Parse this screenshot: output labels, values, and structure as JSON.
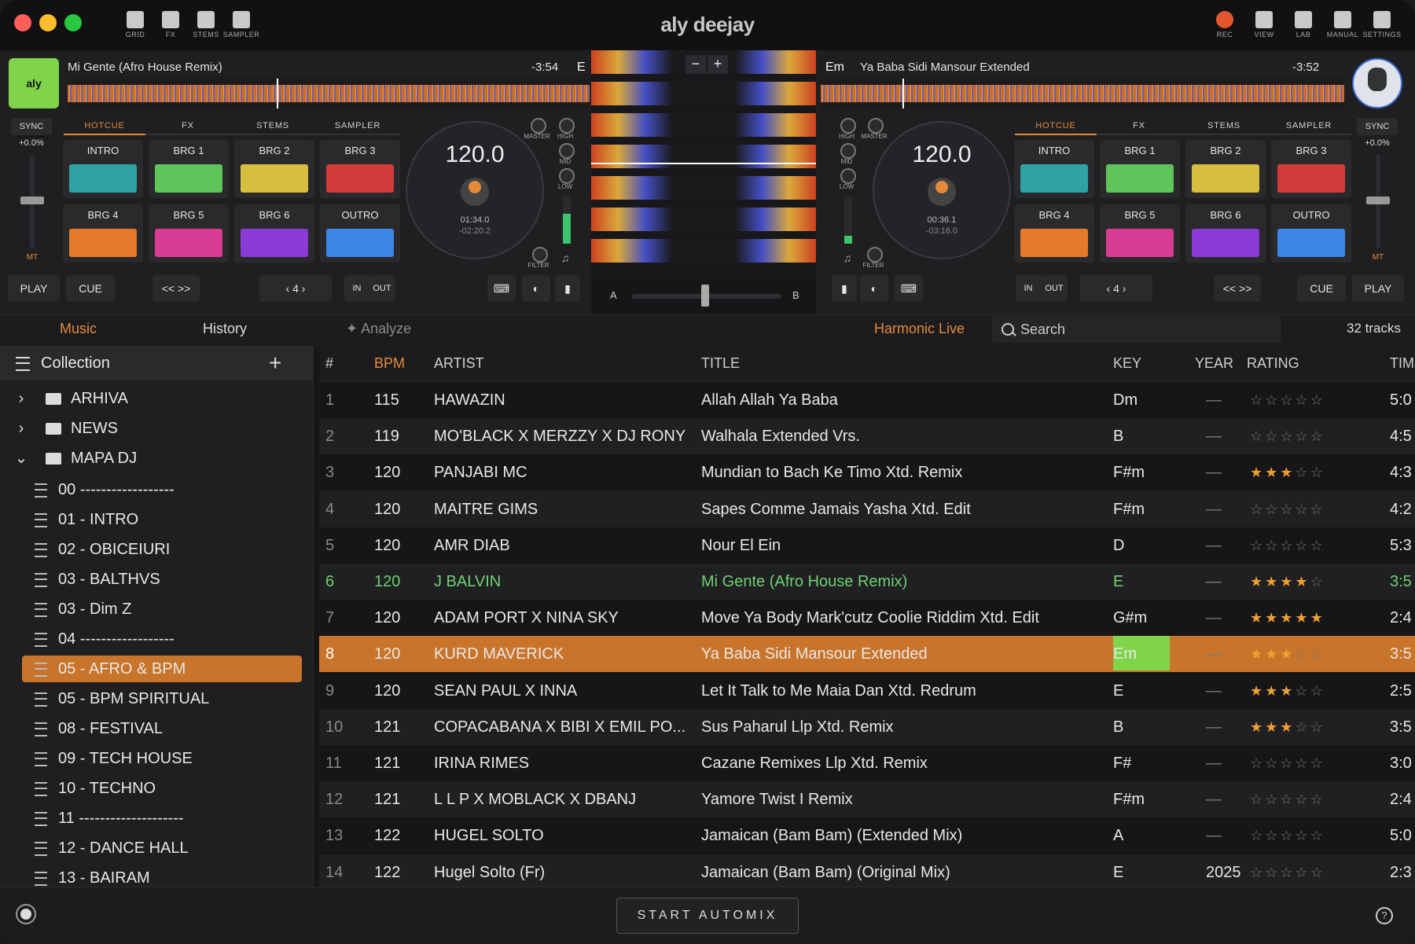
{
  "window": {
    "title": "aly deejay"
  },
  "toolbar_left": [
    {
      "label": "GRID",
      "icon": "grid-icon"
    },
    {
      "label": "FX",
      "icon": "fx-icon"
    },
    {
      "label": "STEMS",
      "icon": "stems-icon"
    },
    {
      "label": "SAMPLER",
      "icon": "sampler-icon"
    }
  ],
  "toolbar_right": [
    {
      "label": "REC",
      "icon": "record-icon"
    },
    {
      "label": "VIEW",
      "icon": "view-icon"
    },
    {
      "label": "LAB",
      "icon": "flask-icon"
    },
    {
      "label": "MANUAL",
      "icon": "book-icon"
    },
    {
      "label": "SETTINGS",
      "icon": "gear-icon"
    }
  ],
  "deck_left": {
    "logo": "aly deejay",
    "track": "Mi Gente (Afro House Remix)",
    "remaining": "-3:54",
    "key": "E",
    "tabs": [
      "HOTCUE",
      "FX",
      "STEMS",
      "SAMPLER"
    ],
    "sync": "SYNC",
    "pitch": "+0.0%",
    "mt": "MT",
    "bpm": "120.0",
    "elapsed": "01:34.0",
    "remain": "-02:20.2",
    "pads": [
      {
        "label": "INTRO",
        "color": "#2fa3a3"
      },
      {
        "label": "BRG 1",
        "color": "#5fc45a"
      },
      {
        "label": "BRG 2",
        "color": "#d6be3f"
      },
      {
        "label": "BRG 3",
        "color": "#d33b3b"
      },
      {
        "label": "BRG 4",
        "color": "#e47a2a"
      },
      {
        "label": "BRG 5",
        "color": "#d83d93"
      },
      {
        "label": "BRG 6",
        "color": "#8a3bd6"
      },
      {
        "label": "OUTRO",
        "color": "#3b86e6"
      }
    ],
    "play": "PLAY",
    "cue": "CUE",
    "seek": "<< >>",
    "loop": "4",
    "in": "IN",
    "out": "OUT",
    "knobs": {
      "master": "MASTER",
      "high": "HIGH",
      "mid": "MID",
      "low": "LOW",
      "filter": "FILTER"
    }
  },
  "deck_right": {
    "track": "Ya Baba Sidi Mansour Extended",
    "remaining": "-3:52",
    "key": "Em",
    "tabs": [
      "HOTCUE",
      "FX",
      "STEMS",
      "SAMPLER"
    ],
    "sync": "SYNC",
    "pitch": "+0.0%",
    "mt": "MT",
    "bpm": "120.0",
    "elapsed": "00:36.1",
    "remain": "-03:16.0",
    "pads": [
      {
        "label": "INTRO",
        "color": "#2fa3a3"
      },
      {
        "label": "BRG 1",
        "color": "#5fc45a"
      },
      {
        "label": "BRG 2",
        "color": "#d6be3f"
      },
      {
        "label": "BRG 3",
        "color": "#d33b3b"
      },
      {
        "label": "BRG 4",
        "color": "#e47a2a"
      },
      {
        "label": "BRG 5",
        "color": "#d83d93"
      },
      {
        "label": "BRG 6",
        "color": "#8a3bd6"
      },
      {
        "label": "OUTRO",
        "color": "#3b86e6"
      }
    ],
    "play": "PLAY",
    "cue": "CUE",
    "seek": "<< >>",
    "loop": "4",
    "in": "IN",
    "out": "OUT",
    "knobs": {
      "master": "MASTER",
      "high": "HIGH",
      "mid": "MID",
      "low": "LOW",
      "filter": "FILTER"
    }
  },
  "mixer": {
    "zoom_out": "−",
    "zoom_in": "+",
    "a": "A",
    "b": "B"
  },
  "library": {
    "tabs": {
      "music": "Music",
      "history": "History"
    },
    "analyze": "Analyze",
    "harmonic": "Harmonic Live",
    "search_placeholder": "Search",
    "count": "32 tracks",
    "collection": "Collection",
    "add": "+",
    "sidebar": [
      {
        "type": "folder",
        "label": "ARHIVA",
        "chev": "›"
      },
      {
        "type": "folder",
        "label": "NEWS",
        "chev": "›"
      },
      {
        "type": "folder",
        "label": "MAPA DJ",
        "chev": "⌄"
      },
      {
        "type": "list",
        "label": "00 ------------------"
      },
      {
        "type": "list",
        "label": "01 - INTRO"
      },
      {
        "type": "list",
        "label": "02 - OBICEIURI"
      },
      {
        "type": "list",
        "label": "03 - BALTHVS"
      },
      {
        "type": "list",
        "label": "03 - Dim Z"
      },
      {
        "type": "list",
        "label": "04 ------------------"
      },
      {
        "type": "list",
        "label": "05 - AFRO & BPM",
        "selected": true
      },
      {
        "type": "list",
        "label": "05 - BPM SPIRITUAL"
      },
      {
        "type": "list",
        "label": "08 - FESTIVAL"
      },
      {
        "type": "list",
        "label": "09 - TECH HOUSE"
      },
      {
        "type": "list",
        "label": "10 - TECHNO"
      },
      {
        "type": "list",
        "label": "11 --------------------"
      },
      {
        "type": "list",
        "label": "12 - DANCE HALL"
      },
      {
        "type": "list",
        "label": "13 - BAIRAM"
      }
    ],
    "columns": [
      "#",
      "BPM",
      "ARTIST",
      "TITLE",
      "KEY",
      "YEAR",
      "RATING",
      "TIM"
    ],
    "rows": [
      {
        "n": "1",
        "bpm": "115",
        "artist": "HAWAZIN",
        "title": "Allah Allah Ya Baba",
        "key": "Dm",
        "year": "—",
        "rating": 0,
        "time": "5:0"
      },
      {
        "n": "2",
        "bpm": "119",
        "artist": "MO'BLACK X MERZZY X DJ RONY",
        "title": "Walhala Extended Vrs.",
        "key": "B",
        "year": "—",
        "rating": 0,
        "time": "4:5"
      },
      {
        "n": "3",
        "bpm": "120",
        "artist": "PANJABI MC",
        "title": "Mundian to Bach Ke Timo Xtd. Remix",
        "key": "F#m",
        "year": "—",
        "rating": 3,
        "time": "4:3"
      },
      {
        "n": "4",
        "bpm": "120",
        "artist": "MAITRE GIMS",
        "title": "Sapes Comme Jamais Yasha Xtd. Edit",
        "key": "F#m",
        "year": "—",
        "rating": 0,
        "time": "4:2"
      },
      {
        "n": "5",
        "bpm": "120",
        "artist": "AMR DIAB",
        "title": "Nour El Ein",
        "key": "D",
        "year": "—",
        "rating": 0,
        "time": "5:3"
      },
      {
        "n": "6",
        "bpm": "120",
        "artist": "J BALVIN",
        "title": "Mi Gente (Afro House Remix)",
        "key": "E",
        "year": "—",
        "rating": 4,
        "time": "3:5",
        "playing": true
      },
      {
        "n": "7",
        "bpm": "120",
        "artist": "ADAM PORT X NINA SKY",
        "title": "Move Ya Body Mark'cutz Coolie Riddim Xtd. Edit",
        "key": "G#m",
        "year": "—",
        "rating": 5,
        "time": "2:4"
      },
      {
        "n": "8",
        "bpm": "120",
        "artist": "KURD MAVERICK",
        "title": "Ya Baba Sidi Mansour Extended",
        "key": "Em",
        "year": "—",
        "rating": 3,
        "time": "3:5",
        "selected": true
      },
      {
        "n": "9",
        "bpm": "120",
        "artist": "SEAN PAUL X INNA",
        "title": "Let It Talk to Me Maia Dan Xtd. Redrum",
        "key": "E",
        "year": "—",
        "rating": 3,
        "time": "2:5"
      },
      {
        "n": "10",
        "bpm": "121",
        "artist": "COPACABANA X BIBI X EMIL PO...",
        "title": "Sus Paharul Llp Xtd. Remix",
        "key": "B",
        "year": "—",
        "rating": 3,
        "time": "3:5"
      },
      {
        "n": "11",
        "bpm": "121",
        "artist": "IRINA RIMES",
        "title": "Cazane Remixes Llp Xtd. Remix",
        "key": "F#",
        "year": "—",
        "rating": 0,
        "time": "3:0"
      },
      {
        "n": "12",
        "bpm": "121",
        "artist": "L L P X MOBLACK X DBANJ",
        "title": "Yamore Twist I Remix",
        "key": "F#m",
        "year": "—",
        "rating": 0,
        "time": "2:4"
      },
      {
        "n": "13",
        "bpm": "122",
        "artist": "HUGEL SOLTO",
        "title": "Jamaican (Bam Bam) (Extended Mix)",
        "key": "A",
        "year": "—",
        "rating": 0,
        "time": "5:0"
      },
      {
        "n": "14",
        "bpm": "122",
        "artist": "Hugel Solto (Fr)",
        "title": "Jamaican (Bam Bam) (Original Mix)",
        "key": "E",
        "year": "2025",
        "rating": 0,
        "time": "2:3"
      }
    ]
  },
  "footer": {
    "automix": "START AUTOMIX",
    "help": "?"
  },
  "colors": {
    "accent": "#e58a3a",
    "selected_row": "#c8742a",
    "playing": "#6cd270",
    "key_match": "#7fd44a"
  }
}
